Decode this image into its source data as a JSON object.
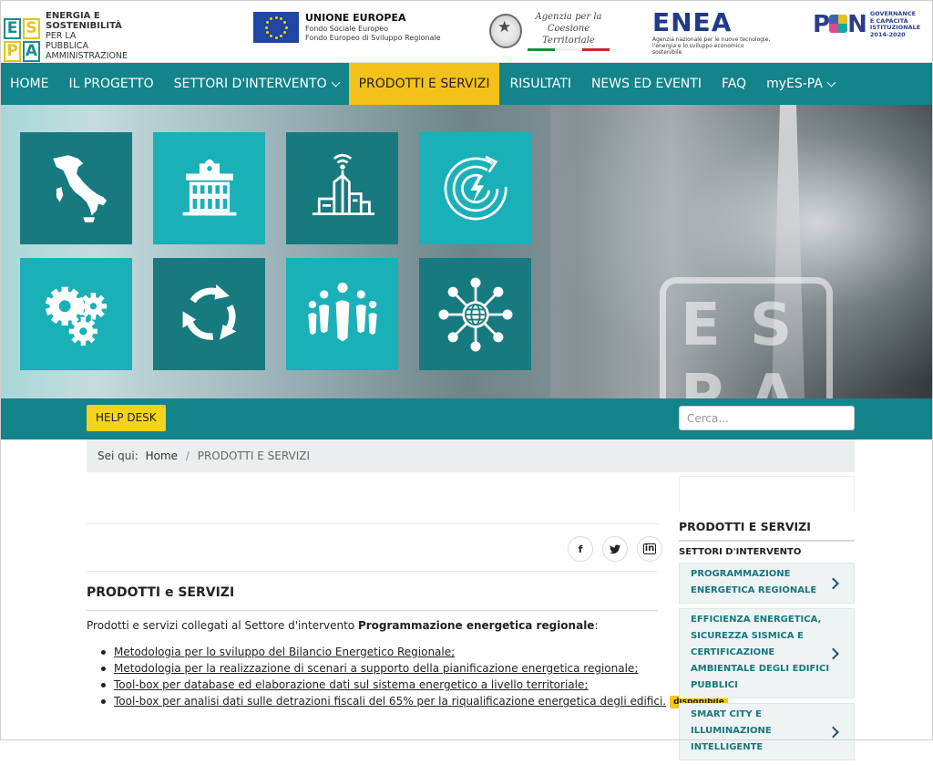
{
  "header": {
    "espa": {
      "mark": [
        "E",
        "S",
        "P",
        "A"
      ],
      "line1": "ENERGIA E SOSTENIBILITÀ",
      "line2": "PER LA",
      "line3": "PUBBLICA AMMINISTRAZIONE"
    },
    "eu": {
      "title": "UNIONE EUROPEA",
      "line1": "Fondo Sociale Europeo",
      "line2": "Fondo Europeo di Sviluppo Regionale"
    },
    "agency": {
      "line1": "Agenzia per la",
      "line2": "Coesione Territoriale"
    },
    "enea": {
      "name": "ENEA",
      "sub": "Agenzia nazionale per le nuove tecnologie, l'energia e lo sviluppo economico sostenibile"
    },
    "pon": {
      "name_pre": "P",
      "name_post": "N",
      "sub": "GOVERNANCE E CAPACITÀ ISTITUZIONALE 2014-2020"
    }
  },
  "nav": [
    {
      "label": "HOME"
    },
    {
      "label": "IL PROGETTO"
    },
    {
      "label": "SETTORI D'INTERVENTO"
    },
    {
      "label": "PRODOTTI E SERVIZI"
    },
    {
      "label": "RISULTATI"
    },
    {
      "label": "NEWS ED EVENTI"
    },
    {
      "label": "FAQ"
    },
    {
      "label": "myES-PA"
    }
  ],
  "hero": {
    "tiles": [
      {
        "icon": "italy-map-icon",
        "color": "#167a7f"
      },
      {
        "icon": "public-building-icon",
        "color": "#1ab0b8"
      },
      {
        "icon": "smart-city-icon",
        "color": "#167a7f"
      },
      {
        "icon": "energy-cycle-icon",
        "color": "#1ab0b8"
      },
      {
        "icon": "gears-icon",
        "color": "#1ab0b8"
      },
      {
        "icon": "recycle-arrows-icon",
        "color": "#167a7f"
      },
      {
        "icon": "community-people-icon",
        "color": "#1ab0b8"
      },
      {
        "icon": "global-network-icon",
        "color": "#167a7f"
      }
    ]
  },
  "helpbar": {
    "helpdesk_label": "HELP DESK",
    "search_placeholder": "Cerca..."
  },
  "breadcrumb": {
    "prefix": "Sei qui:",
    "home": "Home",
    "separator": "/",
    "current": "PRODOTTI E SERVIZI"
  },
  "share": {
    "facebook": "f",
    "twitter": "twitter-icon",
    "linkedin": "in"
  },
  "content": {
    "title": "PRODOTTI e SERVIZI",
    "intro_pre": "Prodotti e servizi collegati al Settore d'intervento ",
    "intro_bold": "Programmazione energetica regionale",
    "intro_post": ":",
    "links": [
      {
        "text": "Metodologia per lo sviluppo del Bilancio Energetico Regionale;"
      },
      {
        "text": "Metodologia per la realizzazione di scenari a supporto della pianificazione energetica regionale;"
      },
      {
        "text": "Tool-box per database ed elaborazione dati sul sistema energetico a livello territoriale;"
      },
      {
        "text": "Tool-box per analisi dati sulle detrazioni fiscali del 65% per la riqualificazione energetica degli edifici.",
        "badge": "disponibile"
      }
    ]
  },
  "sidebar": {
    "title": "PRODOTTI E SERVIZI",
    "subtitle": "SETTORI D'INTERVENTO",
    "items": [
      {
        "label": "PROGRAMMAZIONE ENERGETICA REGIONALE"
      },
      {
        "label": "EFFICIENZA ENERGETICA, SICUREZZA SISMICA E CERTIFICAZIONE AMBIENTALE DEGLI EDIFICI PUBBLICI"
      },
      {
        "label": "SMART CITY E ILLUMINAZIONE INTELLIGENTE"
      }
    ]
  },
  "colors": {
    "teal": "#13848a",
    "tile_dark": "#167a7f",
    "tile_light": "#1ab0b8",
    "accent_yellow": "#f2c21a",
    "sidebar_link": "#17777c"
  }
}
